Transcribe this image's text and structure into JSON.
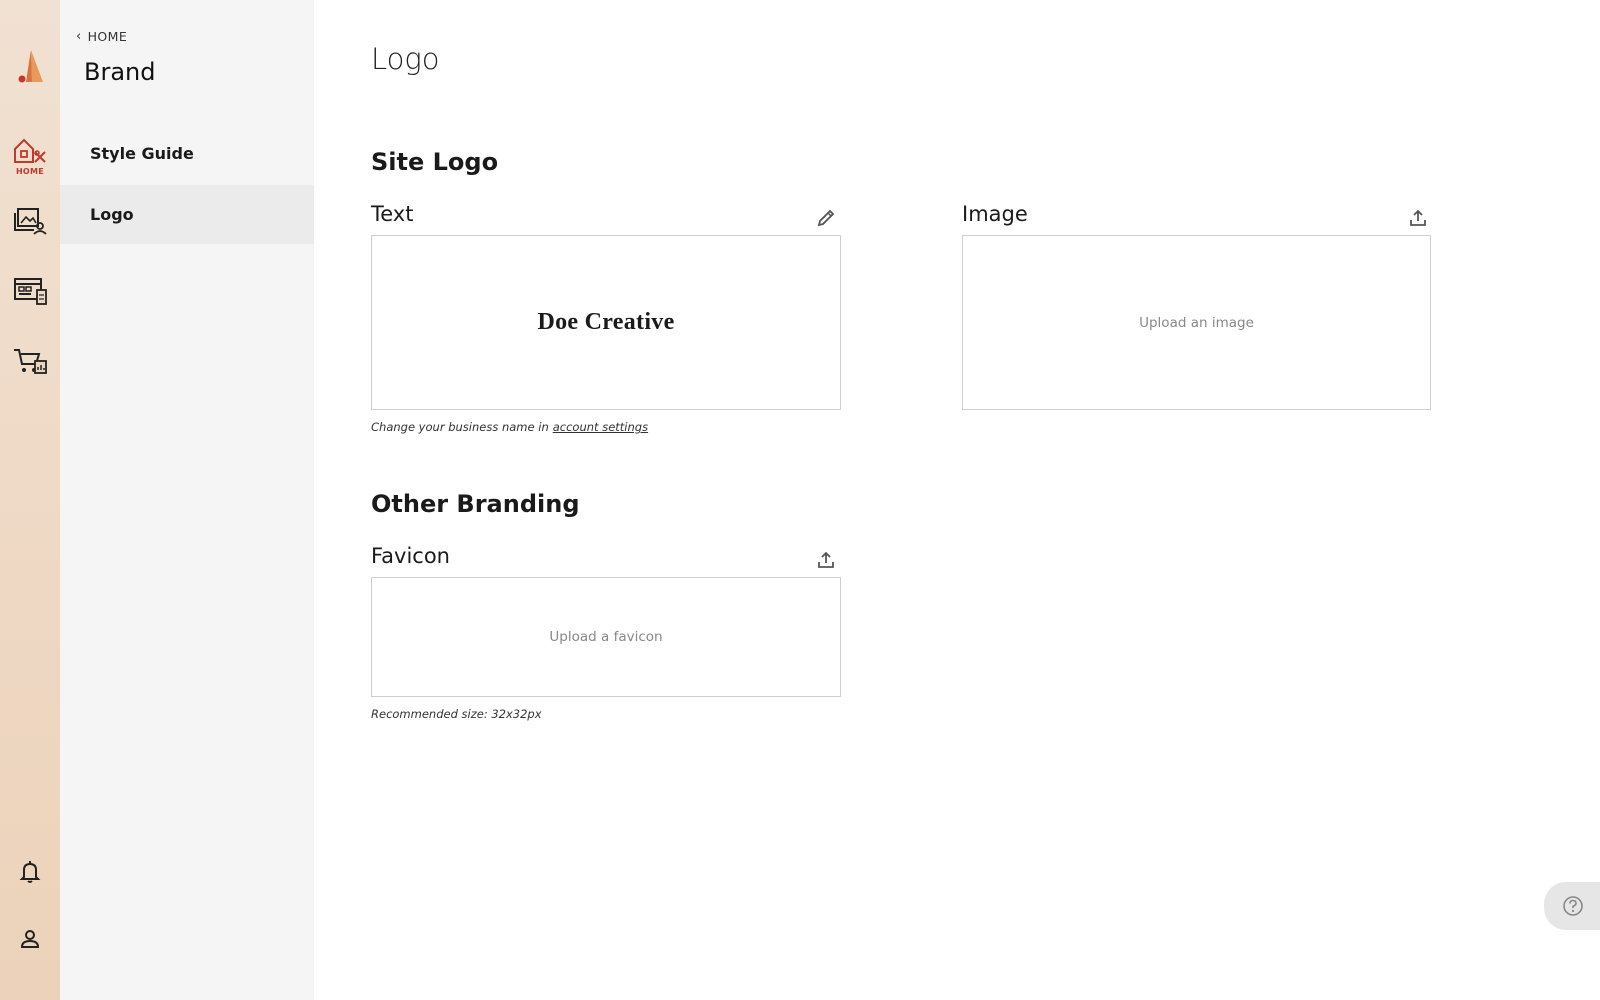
{
  "rail": {
    "items": [
      {
        "icon": "app-logo-icon"
      },
      {
        "icon": "home-tools-icon",
        "label": "HOME"
      },
      {
        "icon": "media-gallery-icon"
      },
      {
        "icon": "website-pages-icon"
      },
      {
        "icon": "store-cart-icon"
      },
      {
        "icon": "bell-icon"
      },
      {
        "icon": "user-icon"
      }
    ],
    "accent": "#c0392b",
    "logo_color": "#e07b39"
  },
  "sidebar": {
    "back_label": "HOME",
    "title": "Brand",
    "items": [
      {
        "label": "Style Guide",
        "active": false
      },
      {
        "label": "Logo",
        "active": true
      }
    ]
  },
  "main": {
    "title": "Logo",
    "site_logo": {
      "heading": "Site Logo",
      "text_field": {
        "label": "Text",
        "action_icon": "pencil-icon",
        "value": "Doe Creative",
        "hint_prefix": "Change your business name in",
        "hint_link": "account settings"
      },
      "image_field": {
        "label": "Image",
        "action_icon": "upload-icon",
        "placeholder": "Upload an image"
      }
    },
    "other_branding": {
      "heading": "Other Branding",
      "favicon": {
        "label": "Favicon",
        "action_icon": "upload-icon",
        "placeholder": "Upload a favicon",
        "hint": "Recommended size: 32x32px"
      }
    }
  },
  "help": {
    "icon": "help-icon"
  }
}
